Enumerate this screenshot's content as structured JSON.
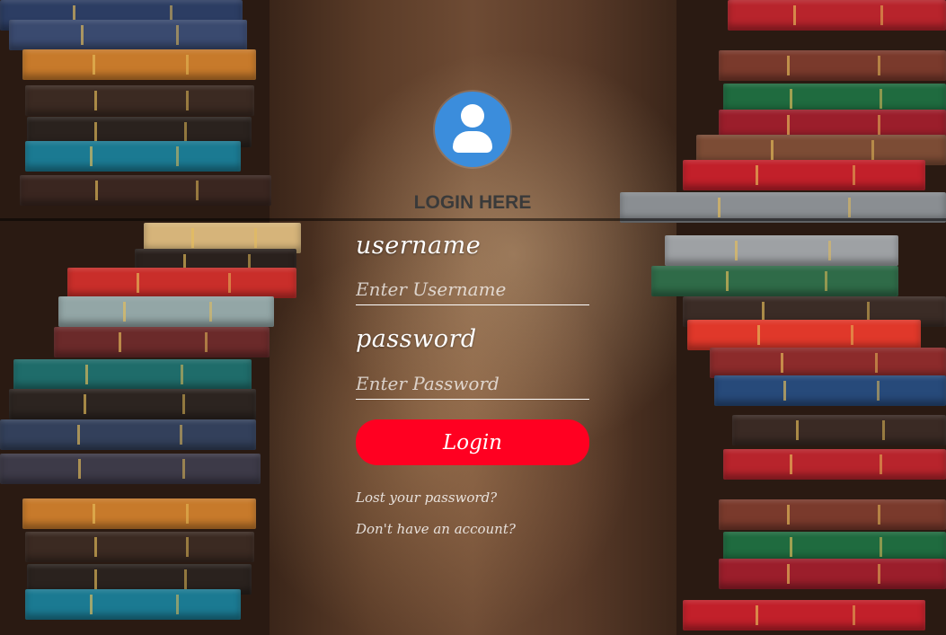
{
  "login": {
    "title": "LOGIN HERE",
    "username_label": "username",
    "username_placeholder": "Enter Username",
    "password_label": "password",
    "password_placeholder": "Enter Password",
    "submit_label": "Login",
    "forgot_link": "Lost your password?",
    "signup_link": "Don't have an account?"
  },
  "icons": {
    "avatar": "user-avatar-icon"
  },
  "colors": {
    "button": "#ff0021",
    "avatar": "#3b8ddc",
    "title": "#3a3a3a"
  }
}
